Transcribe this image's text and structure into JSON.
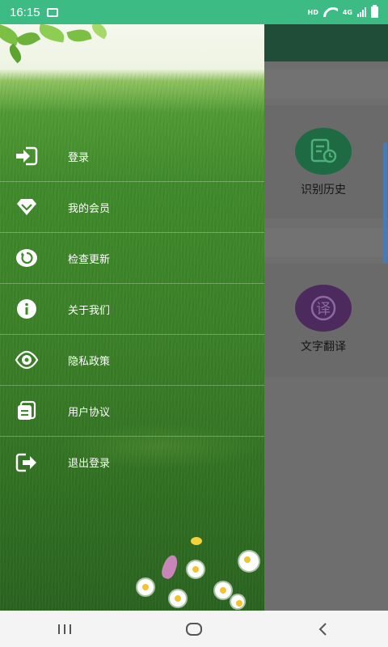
{
  "status_bar": {
    "time": "16:15",
    "network_hd": "HD",
    "network_type": "4G"
  },
  "drawer": {
    "items": [
      {
        "label": "登录",
        "icon": "login-icon"
      },
      {
        "label": "我的会员",
        "icon": "diamond-icon"
      },
      {
        "label": "检查更新",
        "icon": "refresh-icon"
      },
      {
        "label": "关于我们",
        "icon": "info-icon"
      },
      {
        "label": "隐私政策",
        "icon": "privacy-eye-icon"
      },
      {
        "label": "用户协议",
        "icon": "agreement-icon"
      },
      {
        "label": "退出登录",
        "icon": "logout-icon"
      }
    ]
  },
  "main": {
    "features": [
      {
        "label": "识别历史",
        "icon": "history-doc-icon",
        "color": "#1f9e57"
      },
      {
        "label": "文字翻译",
        "icon": "translate-icon",
        "color": "#7a2f86"
      }
    ]
  },
  "colors": {
    "status_bar": "#3dbb84",
    "app_bar": "#1f4d38"
  },
  "navigation": {
    "recent_icon": "recent-apps-icon",
    "home_icon": "home-icon",
    "back_icon": "back-icon"
  }
}
